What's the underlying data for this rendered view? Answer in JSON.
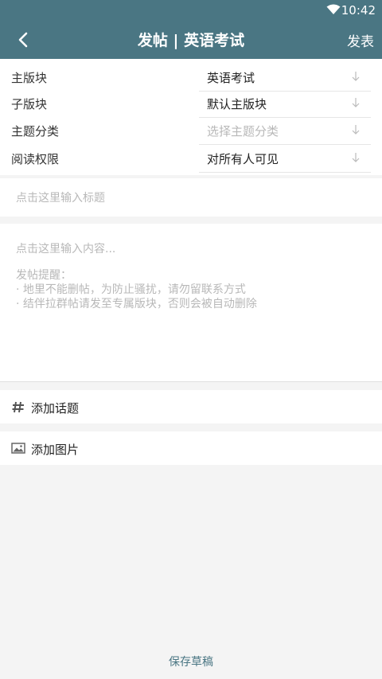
{
  "status_bar": {
    "time": "10:42",
    "wifi_icon": "wifi-icon"
  },
  "toolbar": {
    "title": "发帖 | 英语考试",
    "publish_label": "发表",
    "back_icon": "back-arrow-icon"
  },
  "form": {
    "rows": [
      {
        "label": "主版块",
        "value": "英语考试",
        "placeholder": false
      },
      {
        "label": "子版块",
        "value": "默认主版块",
        "placeholder": false
      },
      {
        "label": "主题分类",
        "value": "选择主题分类",
        "placeholder": true
      },
      {
        "label": "阅读权限",
        "value": "对所有人可见",
        "placeholder": false
      }
    ]
  },
  "title_input": {
    "placeholder": "点击这里输入标题"
  },
  "content_input": {
    "placeholder": "点击这里输入内容...",
    "tips_heading": "发帖提醒：",
    "tips": [
      "· 地里不能删帖，为防止骚扰，请勿留联系方式",
      "· 结伴拉群帖请发至专属版块，否则会被自动删除"
    ]
  },
  "actions": {
    "add_topic": "添加话题",
    "add_image": "添加图片"
  },
  "footer": {
    "save_draft": "保存草稿"
  },
  "colors": {
    "primary": "#4a7683",
    "background": "#f4f4f4",
    "placeholder": "#b8b8b8"
  }
}
